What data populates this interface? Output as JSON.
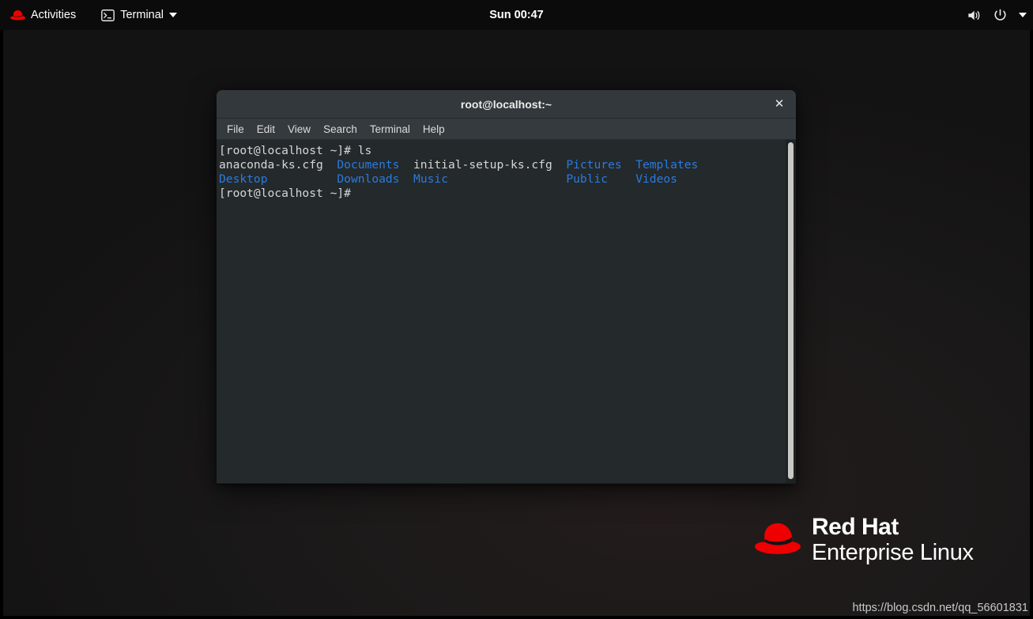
{
  "topbar": {
    "activities_label": "Activities",
    "activities_icon": "redhat-fedora-icon",
    "app_label": "Terminal",
    "app_icon": "terminal-icon",
    "app_caret_icon": "chevron-down-icon",
    "clock": "Sun 00:47",
    "volume_icon": "volume-icon",
    "power_icon": "power-icon",
    "menu_caret_icon": "chevron-down-icon",
    "background_color": "#0b0b0b"
  },
  "terminal_window": {
    "title": "root@localhost:~",
    "close_label": "✕",
    "menus": [
      {
        "label": "File"
      },
      {
        "label": "Edit"
      },
      {
        "label": "View"
      },
      {
        "label": "Search"
      },
      {
        "label": "Terminal"
      },
      {
        "label": "Help"
      }
    ],
    "prompt": "[root@localhost ~]#",
    "command": "ls",
    "lines": [
      {
        "text": "[root@localhost ~]# ls",
        "segments": [
          {
            "text": "[root@localhost ~]# ls",
            "kind": "file"
          }
        ]
      },
      {
        "text": "anaconda-ks.cfg  Documents  initial-setup-ks.cfg  Pictures  Templates",
        "segments": [
          {
            "text": "anaconda-ks.cfg  ",
            "kind": "file"
          },
          {
            "text": "Documents",
            "kind": "dir"
          },
          {
            "text": "  initial-setup-ks.cfg  ",
            "kind": "file"
          },
          {
            "text": "Pictures",
            "kind": "dir"
          },
          {
            "text": "  ",
            "kind": "file"
          },
          {
            "text": "Templates",
            "kind": "dir"
          }
        ]
      },
      {
        "text": "Desktop          Downloads  Music                 Public    Videos",
        "segments": [
          {
            "text": "Desktop",
            "kind": "dir"
          },
          {
            "text": "          ",
            "kind": "file"
          },
          {
            "text": "Downloads",
            "kind": "dir"
          },
          {
            "text": "  ",
            "kind": "file"
          },
          {
            "text": "Music",
            "kind": "dir"
          },
          {
            "text": "                 ",
            "kind": "file"
          },
          {
            "text": "Public",
            "kind": "dir"
          },
          {
            "text": "    ",
            "kind": "file"
          },
          {
            "text": "Videos",
            "kind": "dir"
          }
        ]
      },
      {
        "text": "[root@localhost ~]#",
        "segments": [
          {
            "text": "[root@localhost ~]#",
            "kind": "file"
          }
        ]
      }
    ],
    "colors": {
      "directory": "#2a7bde",
      "file": "#d6d6d6",
      "body_background": "#24292c",
      "titlebar_background": "#33383c",
      "menubar_background": "#343a3e"
    },
    "scrollbar": {
      "name": "vertical-scrollbar"
    }
  },
  "branding": {
    "line1": "Red Hat",
    "line2": "Enterprise Linux",
    "logo_icon": "redhat-fedora-logo",
    "hat_color": "#ee0000"
  },
  "watermark": {
    "text": "https://blog.csdn.net/qq_56601831"
  }
}
